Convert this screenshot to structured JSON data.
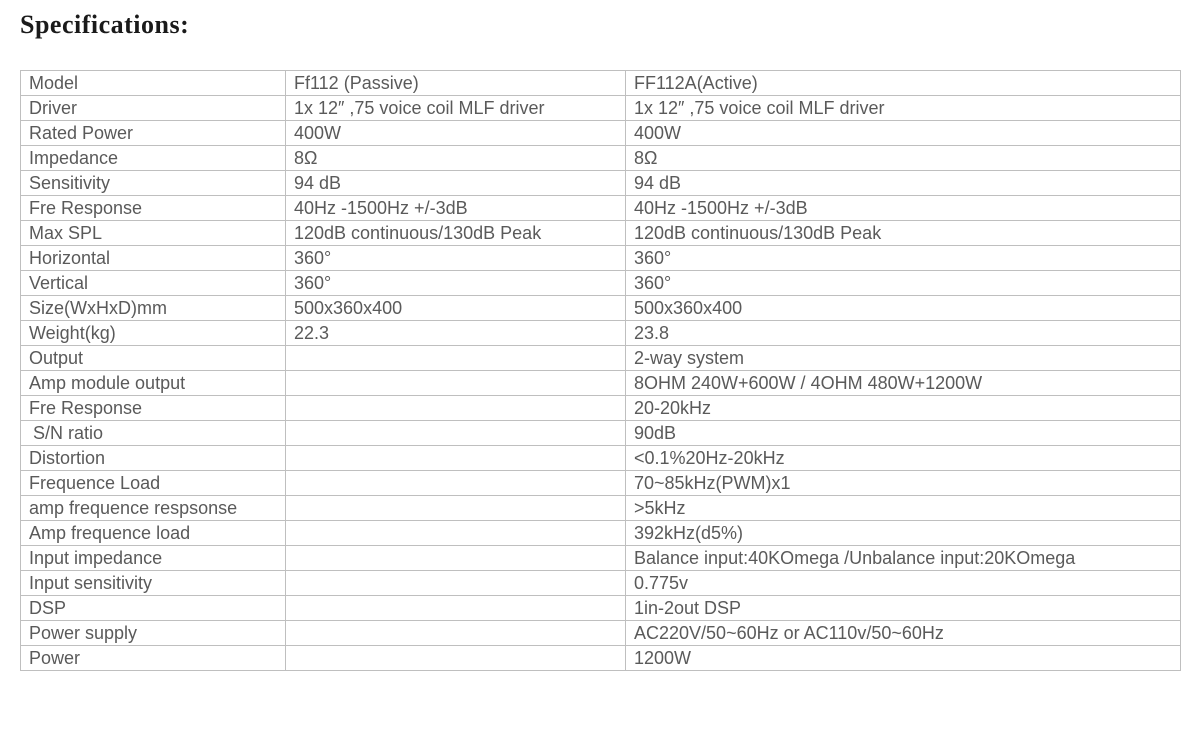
{
  "title": "Specifications:",
  "chart_data": {
    "type": "table",
    "columns": [
      "",
      "Ff112 (Passive)",
      "FF112A(Active)"
    ],
    "rows": [
      {
        "label": "Model",
        "passive": "Ff112 (Passive)",
        "active": "FF112A(Active)",
        "indent": false
      },
      {
        "label": "Driver",
        "passive": "1x 12″ ,75 voice coil MLF driver",
        "active": "1x 12″ ,75 voice coil MLF driver",
        "indent": false
      },
      {
        "label": "Rated Power",
        "passive": "400W",
        "active": "400W",
        "indent": false
      },
      {
        "label": "Impedance",
        "passive": "8Ω",
        "active": "8Ω",
        "indent": false
      },
      {
        "label": "Sensitivity",
        "passive": "94 dB",
        "active": "94 dB",
        "indent": false
      },
      {
        "label": "Fre Response",
        "passive": "40Hz -1500Hz +/-3dB",
        "active": "40Hz -1500Hz +/-3dB",
        "indent": false
      },
      {
        "label": "Max SPL",
        "passive": "120dB continuous/130dB Peak",
        "active": "120dB continuous/130dB Peak",
        "indent": false
      },
      {
        "label": "Horizontal",
        "passive": "360°",
        "active": "360°",
        "indent": false
      },
      {
        "label": "Vertical",
        "passive": "360°",
        "active": "360°",
        "indent": false
      },
      {
        "label": "Size(WxHxD)mm",
        "passive": "500x360x400",
        "active": "500x360x400",
        "indent": false
      },
      {
        "label": "Weight(kg)",
        "passive": "22.3",
        "active": "23.8",
        "indent": false
      },
      {
        "label": "Output",
        "passive": "",
        "active": "2-way system",
        "indent": false
      },
      {
        "label": "Amp module output",
        "passive": "",
        "active": "8OHM  240W+600W / 4OHM  480W+1200W",
        "indent": false
      },
      {
        "label": "Fre Response",
        "passive": "",
        "active": "20-20kHz",
        "indent": false
      },
      {
        "label": "S/N ratio",
        "passive": "",
        "active": "90dB",
        "indent": true
      },
      {
        "label": "Distortion",
        "passive": "",
        "active": "<0.1%20Hz-20kHz",
        "indent": false
      },
      {
        "label": "Frequence Load",
        "passive": "",
        "active": "70~85kHz(PWM)x1",
        "indent": false
      },
      {
        "label": "amp frequence respsonse",
        "passive": "",
        "active": ">5kHz",
        "indent": false
      },
      {
        "label": "Amp frequence load",
        "passive": "",
        "active": "392kHz(d5%)",
        "indent": false
      },
      {
        "label": "Input impedance",
        "passive": "",
        "active": "Balance input:40KOmega /Unbalance input:20KOmega",
        "indent": false
      },
      {
        "label": "Input sensitivity",
        "passive": "",
        "active": "0.775v",
        "indent": false
      },
      {
        "label": "DSP",
        "passive": "",
        "active": "1in-2out DSP",
        "indent": false
      },
      {
        "label": "Power supply",
        "passive": "",
        "active": "AC220V/50~60Hz or AC110v/50~60Hz",
        "indent": false
      },
      {
        "label": "Power",
        "passive": "",
        "active": "1200W",
        "indent": false
      }
    ]
  }
}
